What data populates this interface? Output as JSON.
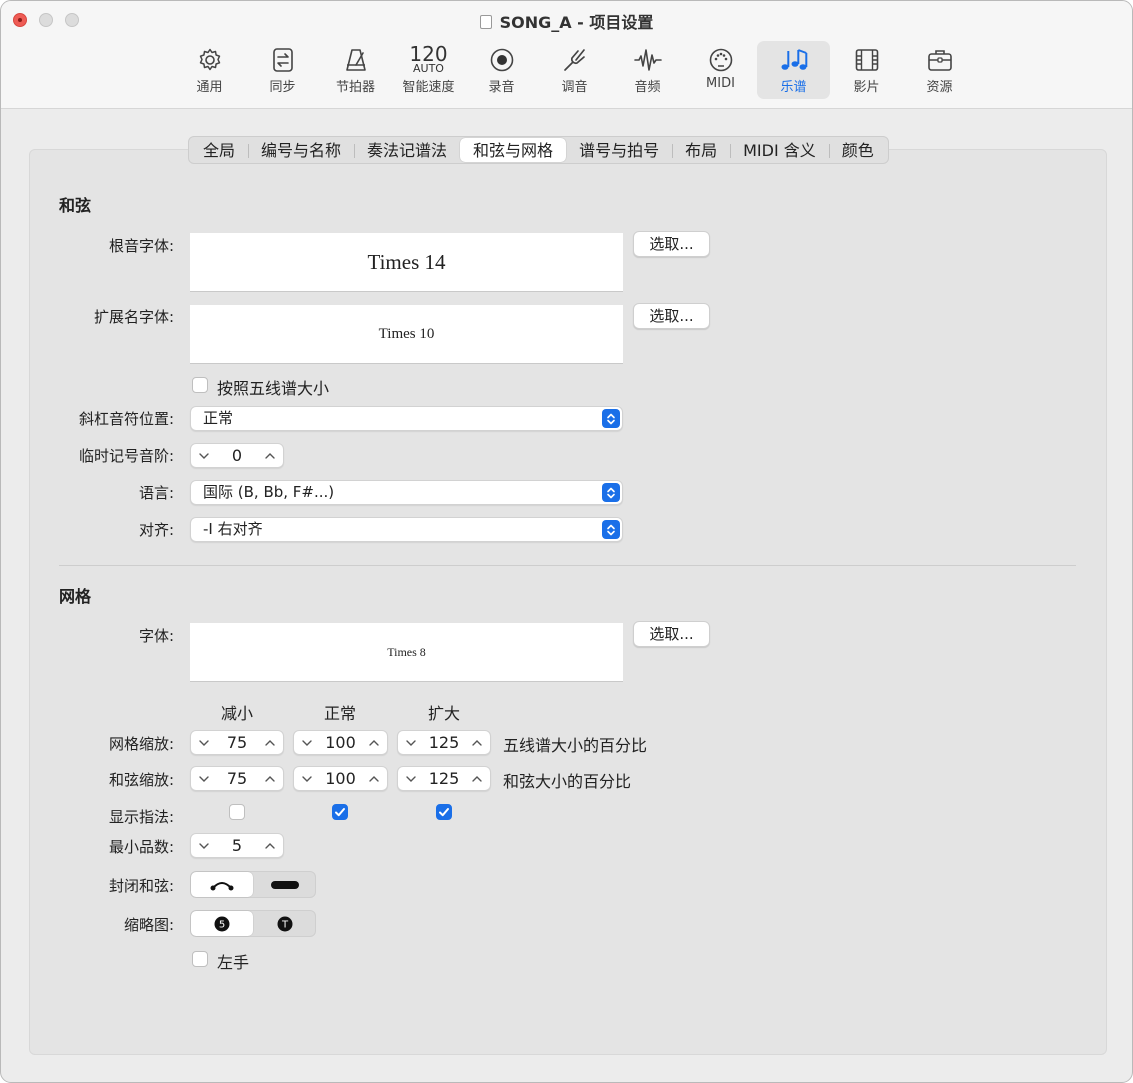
{
  "window": {
    "title": "SONG_A - 项目设置"
  },
  "toolbar": {
    "items": [
      {
        "label": "通用",
        "icon": "gear-icon"
      },
      {
        "label": "同步",
        "icon": "sync-icon"
      },
      {
        "label": "节拍器",
        "icon": "metronome-icon"
      },
      {
        "label": "智能速度",
        "icon": "smart-tempo-icon",
        "tempo_value": "120",
        "tempo_mode": "AUTO"
      },
      {
        "label": "录音",
        "icon": "record-icon"
      },
      {
        "label": "调音",
        "icon": "tuning-fork-icon"
      },
      {
        "label": "音频",
        "icon": "waveform-icon"
      },
      {
        "label": "MIDI",
        "icon": "midi-port-icon"
      },
      {
        "label": "乐谱",
        "icon": "score-notes-icon",
        "active": true
      },
      {
        "label": "影片",
        "icon": "film-icon"
      },
      {
        "label": "资源",
        "icon": "briefcase-icon"
      }
    ]
  },
  "tabs": [
    "全局",
    "编号与名称",
    "奏法记谱法",
    "和弦与网格",
    "谱号与拍号",
    "布局",
    "MIDI 含义",
    "颜色"
  ],
  "active_tab": "和弦与网格",
  "chords": {
    "section_title": "和弦",
    "root_font_label": "根音字体:",
    "root_font_value": "Times 14",
    "extension_font_label": "扩展名字体:",
    "extension_font_value": "Times 10",
    "choose_label": "选取...",
    "scale_with_staff_label": "按照五线谱大小",
    "scale_with_staff_checked": false,
    "slash_position_label": "斜杠音符位置:",
    "slash_position_value": "正常",
    "accidental_label": "临时记号音阶:",
    "accidental_value": "0",
    "language_label": "语言:",
    "language_value": "国际 (B, Bb, F#...)",
    "align_label": "对齐:",
    "align_value": "-I 右对齐"
  },
  "grid": {
    "section_title": "网格",
    "font_label": "字体:",
    "font_value": "Times 8",
    "choose_label": "选取...",
    "col_reduced": "减小",
    "col_normal": "正常",
    "col_enlarged": "扩大",
    "grid_scale_label": "网格缩放:",
    "grid_scale": [
      "75",
      "100",
      "125"
    ],
    "grid_scale_hint": "五线谱大小的百分比",
    "chord_scale_label": "和弦缩放:",
    "chord_scale": [
      "75",
      "100",
      "125"
    ],
    "chord_scale_hint": "和弦大小的百分比",
    "show_fingering_label": "显示指法:",
    "show_fingering": [
      false,
      true,
      true
    ],
    "min_frets_label": "最小品数:",
    "min_frets_value": "5",
    "closed_chords_label": "封闭和弦:",
    "closed_chords_selected": "barre-curve",
    "thumbnail_label": "缩略图:",
    "thumbnail_options": [
      "5",
      "T"
    ],
    "thumbnail_selected": "5",
    "left_hand_label": "左手",
    "left_hand_checked": false
  },
  "colors": {
    "accent": "#1a6fe8",
    "close_button": "#ee5c55"
  }
}
